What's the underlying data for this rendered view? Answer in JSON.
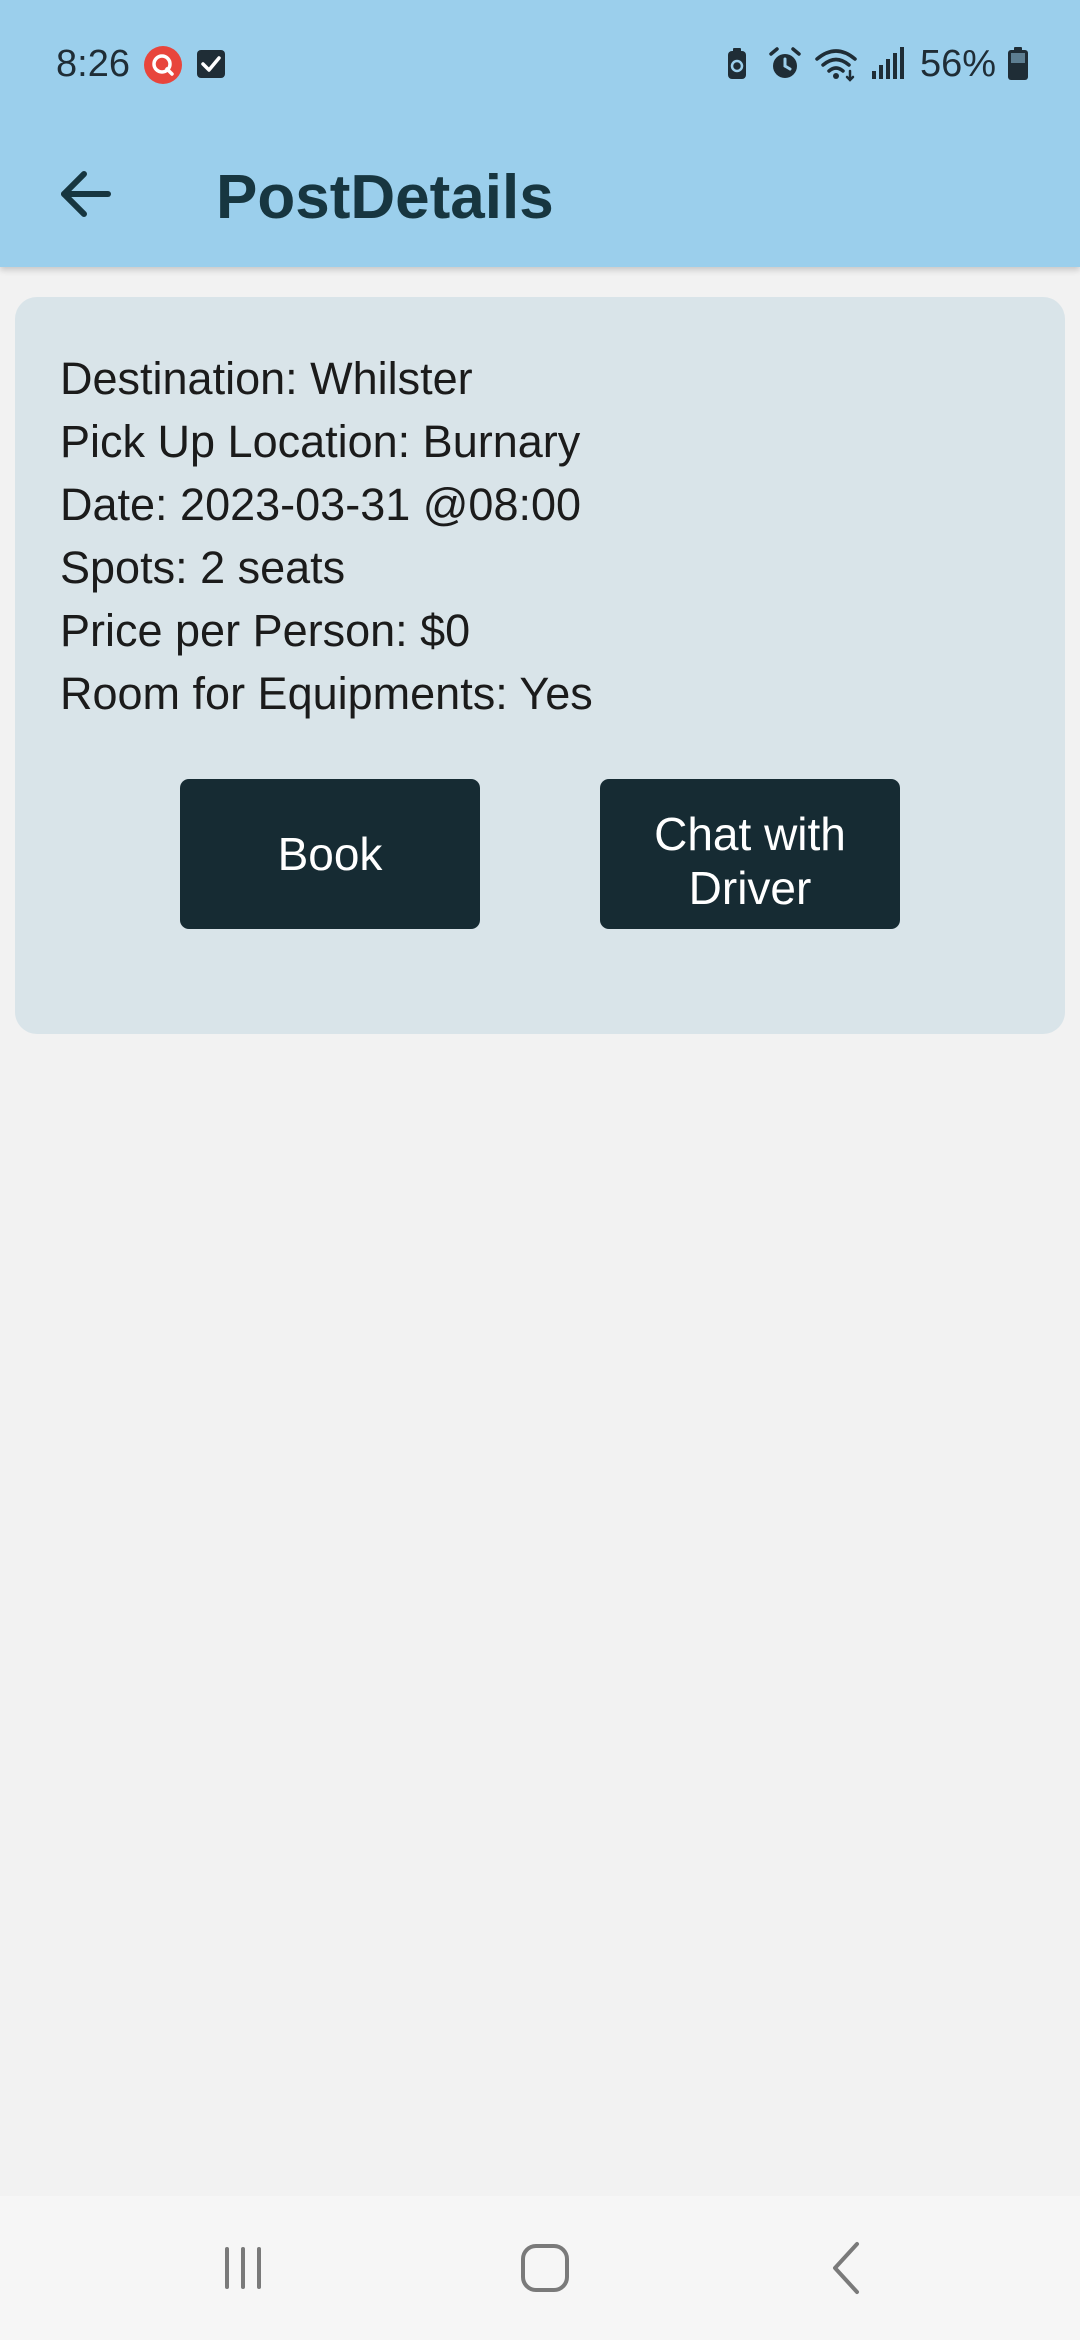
{
  "status_bar": {
    "time": "8:26",
    "battery_percent": "56%"
  },
  "app_bar": {
    "title": "PostDetails"
  },
  "post": {
    "destination": "Destination: Whilster",
    "pickup": "Pick Up Location: Burnary",
    "date": "Date: 2023-03-31 @08:00",
    "spots": "Spots: 2 seats",
    "price": "Price per Person: $0",
    "equipment": "Room for Equipments: Yes"
  },
  "actions": {
    "book_label": "Book",
    "chat_label": "Chat with Driver"
  },
  "colors": {
    "header": "#9bcfec",
    "card": "#d9e4e9",
    "button": "#162b33",
    "background": "#f2f2f2"
  }
}
